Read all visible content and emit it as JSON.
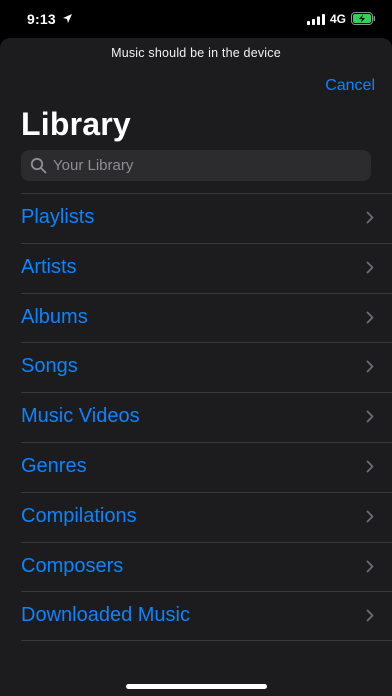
{
  "status_bar": {
    "time": "9:13",
    "network": "4G"
  },
  "sheet": {
    "prompt": "Music should be in the device",
    "cancel_label": "Cancel",
    "title": "Library",
    "search": {
      "placeholder": "Your Library",
      "value": ""
    },
    "items": [
      {
        "label": "Playlists"
      },
      {
        "label": "Artists"
      },
      {
        "label": "Albums"
      },
      {
        "label": "Songs"
      },
      {
        "label": "Music Videos"
      },
      {
        "label": "Genres"
      },
      {
        "label": "Compilations"
      },
      {
        "label": "Composers"
      },
      {
        "label": "Downloaded Music"
      }
    ]
  },
  "icons": {
    "location": "location-arrow-icon",
    "signal": "cellular-signal-icon",
    "battery": "battery-charging-icon",
    "search": "search-icon",
    "chevron": "chevron-right-icon"
  },
  "colors": {
    "accent": "#0a84ff",
    "sheet_background": "#1c1c1e",
    "search_background": "#2c2c2e",
    "separator": "#38383a",
    "battery_fill": "#30d158"
  }
}
